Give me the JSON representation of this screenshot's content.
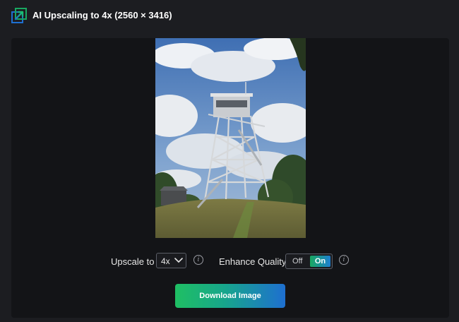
{
  "header": {
    "title": "AI Upscaling to 4x (2560 × 3416)",
    "icon": "upscale-arrow-icon",
    "icon_colors": [
      "#1e6fd0",
      "#19a861"
    ]
  },
  "preview": {
    "content": "photo of a steel lookout tower on a grassy hill under a cloudy blue sky"
  },
  "controls": {
    "upscale_label": "Upscale to",
    "upscale_value": "4x",
    "enhance_label": "Enhance Quality",
    "toggle_off": "Off",
    "toggle_on": "On",
    "toggle_state": "On",
    "info_glyph": "i"
  },
  "actions": {
    "download_label": "Download Image"
  },
  "colors": {
    "background": "#1c1d21",
    "panel": "#131417",
    "accent_green": "#1fbf63",
    "accent_blue": "#1e6fd0"
  }
}
